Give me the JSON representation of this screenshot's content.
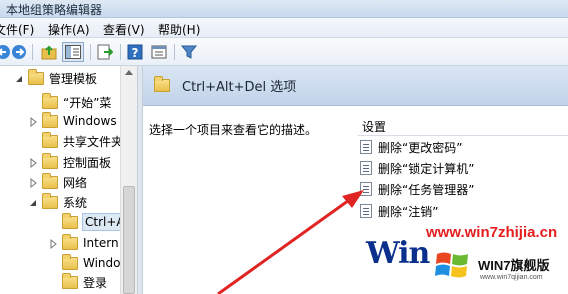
{
  "window": {
    "title": "本地组策略编辑器"
  },
  "menu": [
    {
      "label": "文件(F)"
    },
    {
      "label": "操作(A)"
    },
    {
      "label": "查看(V)"
    },
    {
      "label": "帮助(H)"
    }
  ],
  "toolbar": {
    "buttons": [
      "back-icon",
      "forward-icon",
      "up-folder-icon",
      "show-hide-tree-icon",
      "export-list-icon",
      "help-icon",
      "properties-icon",
      "filter-icon"
    ]
  },
  "tree": {
    "items": [
      {
        "label": "管理模板",
        "expander": "expanded"
      },
      {
        "label": "“开始”菜",
        "expander": "none"
      },
      {
        "label": "Windows",
        "expander": "collapsed"
      },
      {
        "label": "共享文件夹",
        "expander": "none"
      },
      {
        "label": "控制面板",
        "expander": "collapsed"
      },
      {
        "label": "网络",
        "expander": "collapsed"
      },
      {
        "label": "系统",
        "expander": "expanded"
      },
      {
        "label": "Ctrl+Al",
        "expander": "none",
        "selected": true
      },
      {
        "label": "Intern",
        "expander": "collapsed"
      },
      {
        "label": "Windo",
        "expander": "none"
      },
      {
        "label": "登录",
        "expander": "none"
      }
    ]
  },
  "content": {
    "header_title": "Ctrl+Alt+Del 选项",
    "description": "选择一个项目来查看它的描述。",
    "settings_header": "设置",
    "settings": [
      {
        "label": "删除“更改密码”"
      },
      {
        "label": "删除“锁定计算机”"
      },
      {
        "label": "删除“任务管理器”"
      },
      {
        "label": "删除“注销”"
      }
    ]
  },
  "watermark": {
    "url": "www.win7zhijia.cn",
    "big": "Win",
    "brand": "WIN7旗舰版",
    "site": "www.win7qijian.com"
  },
  "colors": {
    "header_blue": "#c2d4ea",
    "arrow_red": "#e02424",
    "watermark_blue": "#0a2f8c"
  }
}
